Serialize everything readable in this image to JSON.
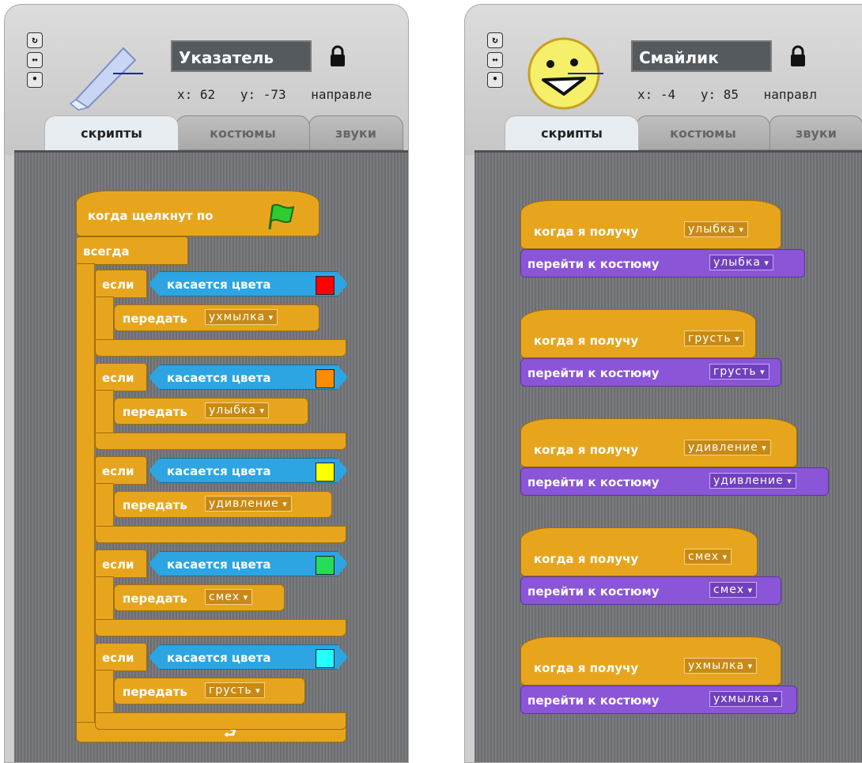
{
  "left_panel": {
    "sprite_name": "Указатель",
    "coords": {
      "x": "x: 62",
      "y": "y: -73",
      "direction": "направле"
    },
    "tabs": [
      "скрипты",
      "костюмы",
      "звуки"
    ],
    "script": {
      "hat_label": "когда щелкнут по",
      "forever_label": "всегда",
      "if_label": "если",
      "sense_label": "касается цвета",
      "send_label": "передать",
      "conditions": [
        {
          "color": "#ff0000",
          "message": "ухмылка"
        },
        {
          "color": "#ff8c00",
          "message": "улыбка"
        },
        {
          "color": "#ffff00",
          "message": "удивление"
        },
        {
          "color": "#22dd55",
          "message": "смех"
        },
        {
          "color": "#22ffff",
          "message": "грусть"
        }
      ]
    }
  },
  "right_panel": {
    "sprite_name": "Смайлик",
    "coords": {
      "x": "x: -4",
      "y": "y: 85",
      "direction": "направл"
    },
    "tabs": [
      "скрипты",
      "костюмы",
      "звуки"
    ],
    "receive_label": "когда я получу",
    "costume_label": "перейти к костюму",
    "scripts": [
      {
        "message": "улыбка",
        "costume": "улыбка"
      },
      {
        "message": "грусть",
        "costume": "грусть"
      },
      {
        "message": "удивление",
        "costume": "удивление"
      },
      {
        "message": "смех",
        "costume": "смех"
      },
      {
        "message": "ухмылка",
        "costume": "ухмылка"
      }
    ]
  },
  "icons": {
    "rotate": "rotate-icon",
    "left_right": "left-right-icon",
    "no_rotate": "no-rotate-icon",
    "lock": "lock-icon",
    "green_flag": "green-flag-icon",
    "loop_arrow": "loop-arrow-icon"
  }
}
